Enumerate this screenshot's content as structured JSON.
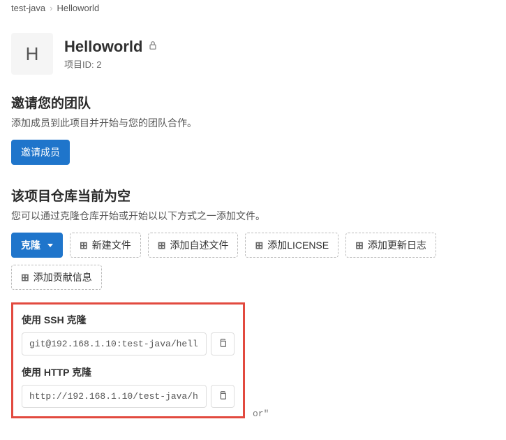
{
  "breadcrumb": {
    "group": "test-java",
    "project": "Helloworld"
  },
  "project": {
    "avatar_letter": "H",
    "name": "Helloworld",
    "id_label": "项目ID: 2"
  },
  "invite": {
    "heading": "邀请您的团队",
    "desc": "添加成员到此项目并开始与您的团队合作。",
    "button": "邀请成员"
  },
  "empty_repo": {
    "heading": "该项目仓库当前为空",
    "desc": "您可以通过克隆仓库开始或开始以以下方式之一添加文件。"
  },
  "buttons": {
    "clone": "克隆",
    "new_file": "新建文件",
    "add_readme": "添加自述文件",
    "add_license": "添加LICENSE",
    "add_changelog": "添加更新日志",
    "add_contributing": "添加贡献信息"
  },
  "clone_panel": {
    "ssh_label": "使用 SSH 克隆",
    "ssh_url": "git@192.168.1.10:test-java/hell",
    "http_label": "使用 HTTP 克隆",
    "http_url": "http://192.168.1.10/test-java/h"
  },
  "stray_text": "or\""
}
